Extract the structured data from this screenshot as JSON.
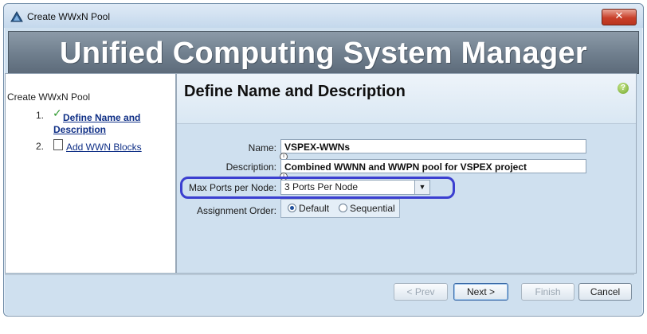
{
  "window": {
    "title": "Create WWxN Pool",
    "close_symbol": "✕"
  },
  "banner": {
    "text": "Unified Computing System Manager"
  },
  "wizard_nav": {
    "title": "Create WWxN Pool",
    "steps": [
      {
        "number": "1.",
        "label": "Define Name and Description",
        "completed": true
      },
      {
        "number": "2.",
        "label": "Add WWN Blocks",
        "completed": false
      }
    ]
  },
  "page": {
    "title": "Define Name and Description",
    "help_symbol": "?"
  },
  "form": {
    "name_label": "Name:",
    "name_value": "VSPEX-WWNs",
    "description_label": "Description:",
    "description_value": "Combined WWNN and WWPN pool for VSPEX project",
    "max_ports_label": "Max Ports per Node:",
    "max_ports_value": "3 Ports Per Node",
    "assignment_order_label": "Assignment Order:",
    "assignment_options": [
      {
        "label": "Default",
        "selected": true
      },
      {
        "label": "Sequential",
        "selected": false
      }
    ]
  },
  "buttons": {
    "prev": "< Prev",
    "next": "Next >",
    "finish": "Finish",
    "cancel": "Cancel"
  },
  "colors": {
    "highlight_oval": "#3b3fd0",
    "link": "#0f2f86",
    "check": "#2f9a2f"
  }
}
